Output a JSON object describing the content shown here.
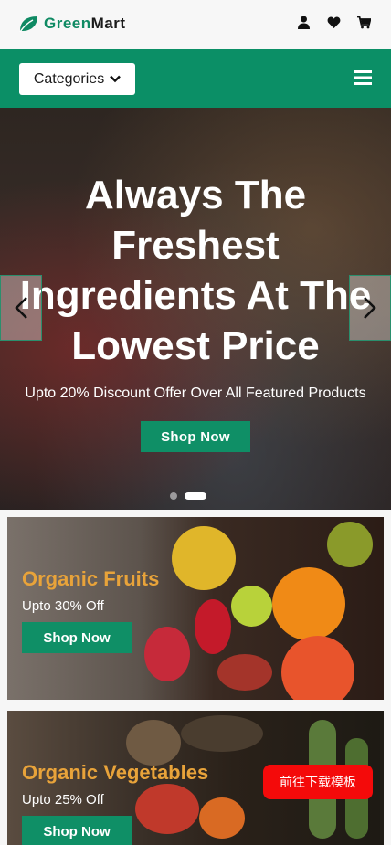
{
  "header": {
    "brand_part1": "Green",
    "brand_part2": "Mart",
    "icons": [
      "user-icon",
      "heart-icon",
      "cart-icon"
    ]
  },
  "nav": {
    "categories_label": "Categories",
    "menu_icon": "hamburger-menu-icon"
  },
  "hero": {
    "title": "Always The Freshest Ingredients At The Lowest Price",
    "subtitle": "Upto 20% Discount Offer Over All Featured Products",
    "button_label": "Shop Now",
    "slides_count": 2,
    "active_slide": 2
  },
  "promos": [
    {
      "title": "Organic Fruits",
      "subtitle": "Upto 30% Off",
      "button_label": "Shop Now"
    },
    {
      "title": "Organic Vegetables",
      "subtitle": "Upto 25% Off",
      "button_label": "Shop Now"
    }
  ],
  "floating_button": {
    "label": "前往下载模板"
  },
  "colors": {
    "brand_green": "#0b8f66",
    "accent_orange": "#e8a33a",
    "cta_red": "#f40a0a"
  }
}
